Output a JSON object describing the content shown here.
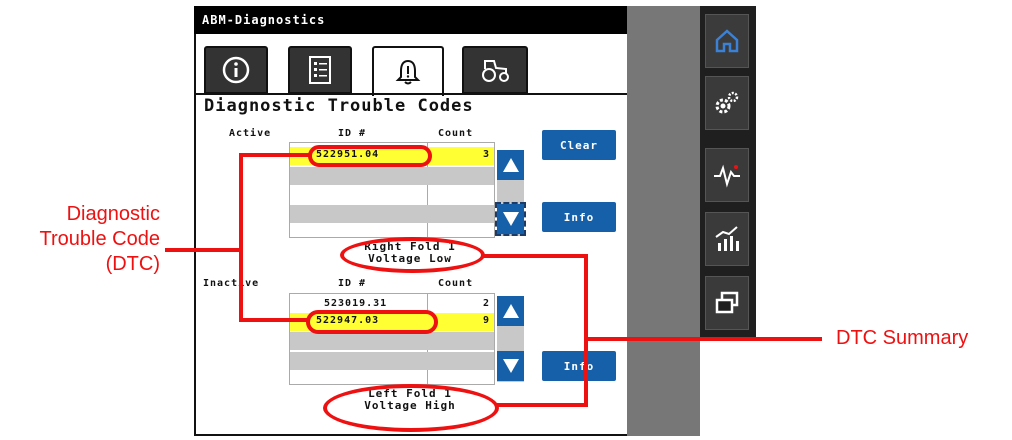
{
  "window": {
    "title": "ABM-Diagnostics"
  },
  "tabs": [
    {
      "icon": "info-icon"
    },
    {
      "icon": "checklist-icon"
    },
    {
      "icon": "alert-bell-icon",
      "active": true
    },
    {
      "icon": "tractor-icon"
    }
  ],
  "page": {
    "heading": "Diagnostic Trouble Codes"
  },
  "active": {
    "label": "Active",
    "id_header": "ID #",
    "count_header": "Count",
    "rows": [
      {
        "id": "522951.04",
        "count": "3",
        "highlight": true
      }
    ],
    "summary_line1": "Right Fold 1",
    "summary_line2": "Voltage Low",
    "clear_label": "Clear",
    "info_label": "Info"
  },
  "inactive": {
    "label": "Inactive",
    "id_header": "ID #",
    "count_header": "Count",
    "rows": [
      {
        "id": "523019.31",
        "count": "2",
        "highlight": false
      },
      {
        "id": "522947.03",
        "count": "9",
        "highlight": true
      }
    ],
    "summary_line1": "Left Fold 1",
    "summary_line2": "Voltage High",
    "info_label": "Info"
  },
  "sidebar": [
    {
      "icon": "home-icon",
      "active": true
    },
    {
      "icon": "settings-gears-icon"
    },
    {
      "icon": "diagnostics-pulse-icon"
    },
    {
      "icon": "performance-chart-icon"
    },
    {
      "icon": "window-switch-icon"
    }
  ],
  "callouts": {
    "dtc_line1": "Diagnostic",
    "dtc_line2": "Trouble Code",
    "dtc_line3": "(DTC)",
    "summary": "DTC Summary"
  },
  "colors": {
    "accent_blue": "#1560a8",
    "highlight_yellow": "#ffff33",
    "callout_red": "#ee1111",
    "panel_gray": "#777777",
    "sidebar_dark": "#1f1f1f"
  }
}
